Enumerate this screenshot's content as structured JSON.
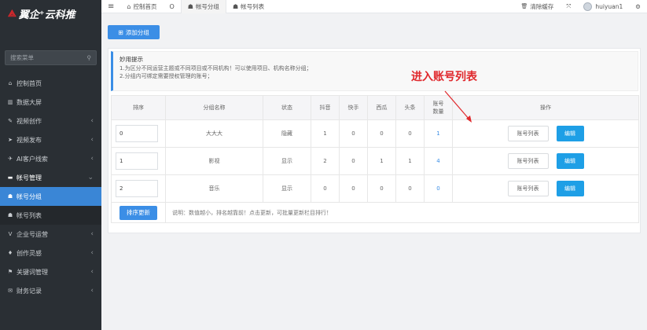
{
  "brand": {
    "logo_mark": "⟁",
    "name": "翼企⁺云科推"
  },
  "sidebar": {
    "search_placeholder": "搜索菜单",
    "items": [
      {
        "label": "控制首页",
        "icon": "⌂"
      },
      {
        "label": "数据大屏",
        "icon": "▥"
      },
      {
        "label": "视频创作",
        "icon": "✎",
        "arrow": "‹"
      },
      {
        "label": "视频发布",
        "icon": "➤",
        "arrow": "‹"
      },
      {
        "label": "AI客户线索",
        "icon": "✈",
        "arrow": "‹"
      },
      {
        "label": "帐号管理",
        "icon": "▬",
        "arrow": "⌄"
      },
      {
        "label": "帐号分组",
        "icon": "☗"
      },
      {
        "label": "帐号列表",
        "icon": "☗"
      },
      {
        "label": "企业号运营",
        "icon": "V",
        "arrow": "‹"
      },
      {
        "label": "创作灵感",
        "icon": "♦",
        "arrow": "‹"
      },
      {
        "label": "关键词管理",
        "icon": "⚑",
        "arrow": "‹"
      },
      {
        "label": "财务记录",
        "icon": "✉",
        "arrow": "‹"
      }
    ]
  },
  "topbar": {
    "menu_icon": "≡",
    "tabs": [
      {
        "label": "控制首页",
        "icon": "⌂"
      },
      {
        "label": "O",
        "icon": ""
      },
      {
        "label": "帐号分组",
        "icon": "☗"
      },
      {
        "label": "帐号列表",
        "icon": "☗"
      }
    ],
    "clear_cache": "清除缓存",
    "clear_icon": "🗑",
    "fullscreen_icon": "⤧",
    "username": "huiyuan1",
    "settings_icon": "⚙"
  },
  "toolbar": {
    "add_group": "添加分组",
    "add_icon": "⊞"
  },
  "tips": {
    "title": "妙用提示",
    "line1": "1.为区分不同运营主题或不同项目或不同机构！可以使用项目、机构名称分组；",
    "line2": "2.分组内可绑定需要授权管理的账号；"
  },
  "table": {
    "headers": [
      "排序",
      "分组名称",
      "状态",
      "抖音",
      "快手",
      "西瓜",
      "头条",
      "账号数量",
      "操作"
    ],
    "rows": [
      {
        "sort": "0",
        "name": "大大大",
        "status": "隐藏",
        "douyin": "1",
        "kuaishou": "0",
        "xigua": "0",
        "toutiao": "0",
        "count": "1"
      },
      {
        "sort": "1",
        "name": "影视",
        "status": "显示",
        "douyin": "2",
        "kuaishou": "0",
        "xigua": "1",
        "toutiao": "1",
        "count": "4"
      },
      {
        "sort": "2",
        "name": "音乐",
        "status": "显示",
        "douyin": "0",
        "kuaishou": "0",
        "xigua": "0",
        "toutiao": "0",
        "count": "0"
      }
    ],
    "action_accounts": "账号列表",
    "action_edit": "编辑",
    "sort_update": "排序更新",
    "footer_note": "说明：数值越小，排名越靠前！点击更新，可批量更新栏目排行！"
  },
  "annotation": {
    "text": "进入账号列表",
    "color": "#e0282c"
  },
  "colors": {
    "sidebar_bg": "#2a2f34",
    "accent": "#3b8ee6",
    "edit_btn": "#1e9fe6"
  }
}
